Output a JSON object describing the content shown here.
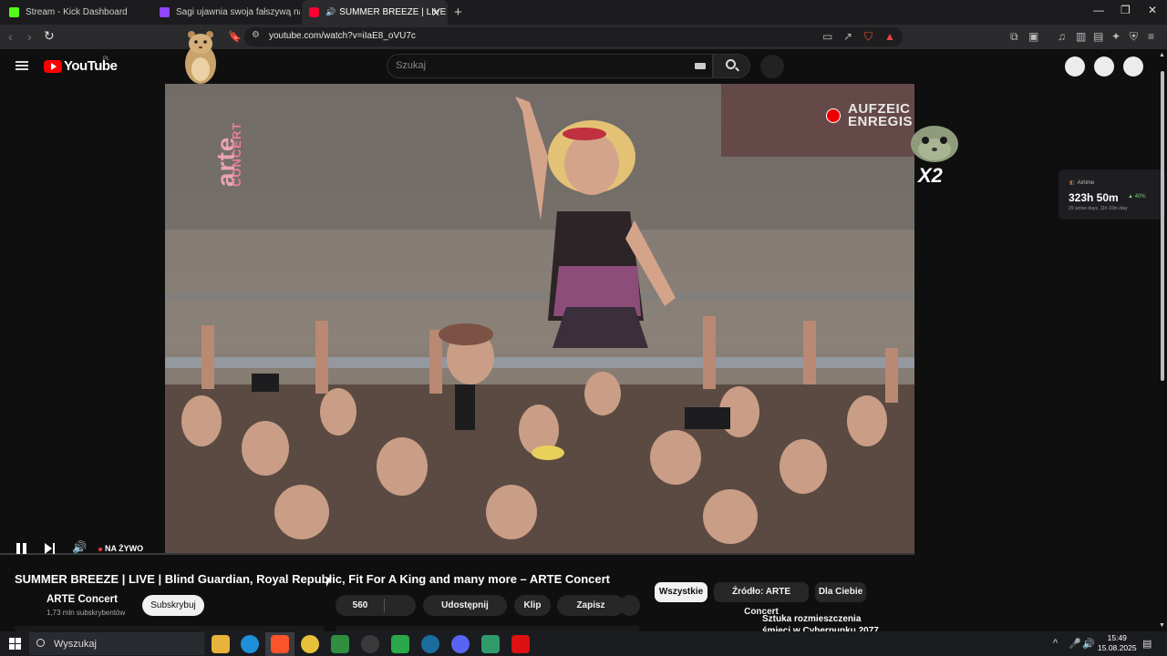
{
  "browser": {
    "tabs": [
      {
        "label": "Stream - Kick Dashboard",
        "favicon_color": "#53fc18"
      },
      {
        "label": "Sagi ujawnia swoja fałszywą nature",
        "favicon_color": "#9146ff"
      },
      {
        "label": "SUMMER BREEZE | LIVE | Blind",
        "favicon_color": "#ff0033"
      }
    ],
    "url": "youtube.com/watch?v=iIaE8_oVU7c"
  },
  "youtube": {
    "logo_text": "YouTube",
    "country_code": "PL",
    "search_placeholder": "Szukaj"
  },
  "player": {
    "watermark_arte": "arte",
    "watermark_concert": "CONCERT",
    "rec_line1": "AUFZEIC",
    "rec_line2": "ENREGIS",
    "live_label": "NA ŻYWO"
  },
  "overlays": {
    "multiplier": "X2",
    "airtime": {
      "label": "Airtime",
      "value": "323h 50m",
      "change": "40%",
      "sub": "29 active days, 11h 10m /day"
    }
  },
  "video": {
    "title": "SUMMER BREEZE | LIVE | Blind Guardian, Royal Republic, Fit For A King and many more – ARTE Concert",
    "channel": "ARTE Concert",
    "subscribers": "1,73 mln subskrybentów",
    "subscribe_label": "Subskrybuj",
    "likes": "560",
    "share_label": "Udostępnij",
    "clip_label": "Klip",
    "save_label": "Zapisz"
  },
  "chips": [
    "Wszystkie",
    "Źródło: ARTE Concert",
    "Dla Ciebie"
  ],
  "recommendation": {
    "title": "Sztuka rozmieszczenia śmieci w Cyberpunku 2077"
  },
  "taskbar": {
    "search_label": "Wyszukaj",
    "time": "15:49",
    "date": "15.08.2025"
  },
  "colors": {
    "youtube_red": "#ff0000",
    "kick_green": "#53fc18"
  }
}
